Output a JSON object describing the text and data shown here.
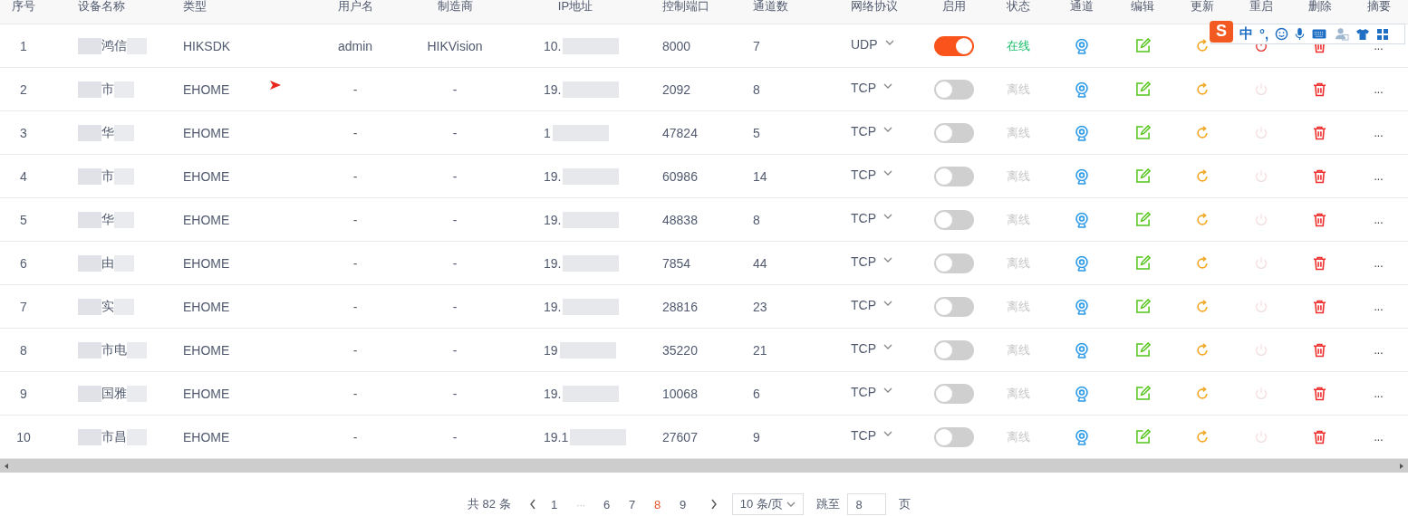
{
  "table": {
    "columns": [
      "序号",
      "设备名称",
      "类型",
      "用户名",
      "制造商",
      "IP地址",
      "控制端口",
      "通道数",
      "网络协议",
      "启用",
      "状态",
      "通道",
      "编辑",
      "更新",
      "重启",
      "删除",
      "摘要"
    ],
    "rows": [
      {
        "seq": "1",
        "name": "鸿信",
        "type": "HIKSDK",
        "user": "admin",
        "maker": "HIKVision",
        "ip": "10.",
        "port": "8000",
        "channels": "7",
        "protocol": "UDP",
        "enabled": true,
        "online": true,
        "status": "在线",
        "summary": "..."
      },
      {
        "seq": "2",
        "name": "市",
        "type": "EHOME",
        "user": "-",
        "maker": "-",
        "ip": "19.",
        "port": "2092",
        "channels": "8",
        "protocol": "TCP",
        "enabled": false,
        "online": false,
        "status": "离线",
        "summary": "..."
      },
      {
        "seq": "3",
        "name": "华",
        "type": "EHOME",
        "user": "-",
        "maker": "-",
        "ip": "1",
        "port": "47824",
        "channels": "5",
        "protocol": "TCP",
        "enabled": false,
        "online": false,
        "status": "离线",
        "summary": "..."
      },
      {
        "seq": "4",
        "name": "市",
        "type": "EHOME",
        "user": "-",
        "maker": "-",
        "ip": "19.",
        "port": "60986",
        "channels": "14",
        "protocol": "TCP",
        "enabled": false,
        "online": false,
        "status": "离线",
        "summary": "..."
      },
      {
        "seq": "5",
        "name": "华",
        "type": "EHOME",
        "user": "-",
        "maker": "-",
        "ip": "19.",
        "port": "48838",
        "channels": "8",
        "protocol": "TCP",
        "enabled": false,
        "online": false,
        "status": "离线",
        "summary": "..."
      },
      {
        "seq": "6",
        "name": "由",
        "type": "EHOME",
        "user": "-",
        "maker": "-",
        "ip": "19.",
        "port": "7854",
        "channels": "44",
        "protocol": "TCP",
        "enabled": false,
        "online": false,
        "status": "离线",
        "summary": "..."
      },
      {
        "seq": "7",
        "name": "实",
        "type": "EHOME",
        "user": "-",
        "maker": "-",
        "ip": "19.",
        "port": "28816",
        "channels": "23",
        "protocol": "TCP",
        "enabled": false,
        "online": false,
        "status": "离线",
        "summary": "..."
      },
      {
        "seq": "8",
        "name": "市电",
        "type": "EHOME",
        "user": "-",
        "maker": "-",
        "ip": "19",
        "port": "35220",
        "channels": "21",
        "protocol": "TCP",
        "enabled": false,
        "online": false,
        "status": "离线",
        "summary": "..."
      },
      {
        "seq": "9",
        "name": "国雅",
        "type": "EHOME",
        "user": "-",
        "maker": "-",
        "ip": "19.",
        "port": "10068",
        "channels": "6",
        "protocol": "TCP",
        "enabled": false,
        "online": false,
        "status": "离线",
        "summary": "..."
      },
      {
        "seq": "10",
        "name": "市昌",
        "type": "EHOME",
        "user": "-",
        "maker": "-",
        "ip": "19.1",
        "port": "27607",
        "channels": "9",
        "protocol": "TCP",
        "enabled": false,
        "online": false,
        "status": "离线",
        "summary": "..."
      }
    ]
  },
  "pagination": {
    "total": "共 82 条",
    "pages": [
      {
        "label": "1",
        "selected": false
      },
      {
        "label": "···",
        "selected": false
      },
      {
        "label": "6",
        "selected": false
      },
      {
        "label": "7",
        "selected": false
      },
      {
        "label": "8",
        "selected": true
      },
      {
        "label": "9",
        "selected": false
      }
    ],
    "page_size": "10 条/页",
    "jump_label": "跳至",
    "jump_value": "8",
    "page_suffix": "页"
  },
  "ime_toolbar": {
    "logo": "S",
    "mode": "中",
    "punctuation": "°,"
  }
}
